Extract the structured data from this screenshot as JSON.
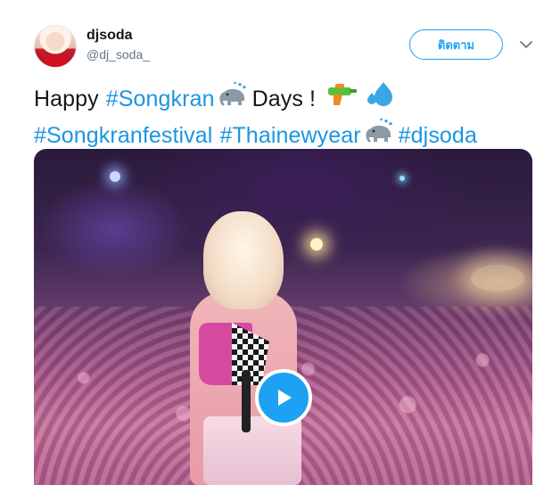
{
  "author": {
    "display_name": "djsoda",
    "username": "@dj_soda_"
  },
  "follow_button": {
    "label": "ติดตาม"
  },
  "tweet": {
    "line1": {
      "word1": "Happy",
      "hashtag1": "#Songkran",
      "word2": "Days !"
    },
    "line2": {
      "hashtag2": "#Songkranfestival",
      "hashtag3": "#Thainewyear",
      "hashtag4": "#djsoda"
    }
  },
  "icons": {
    "more": "chevron-down-icon",
    "elephant": "elephant-splash-emoji",
    "water_gun": "water-pistol-emoji",
    "droplets": "sweat-droplets-emoji",
    "play": "play-icon"
  },
  "colors": {
    "link": "#1b95e0",
    "accent": "#1da1f2",
    "text": "#14171a",
    "secondary": "#657786"
  }
}
